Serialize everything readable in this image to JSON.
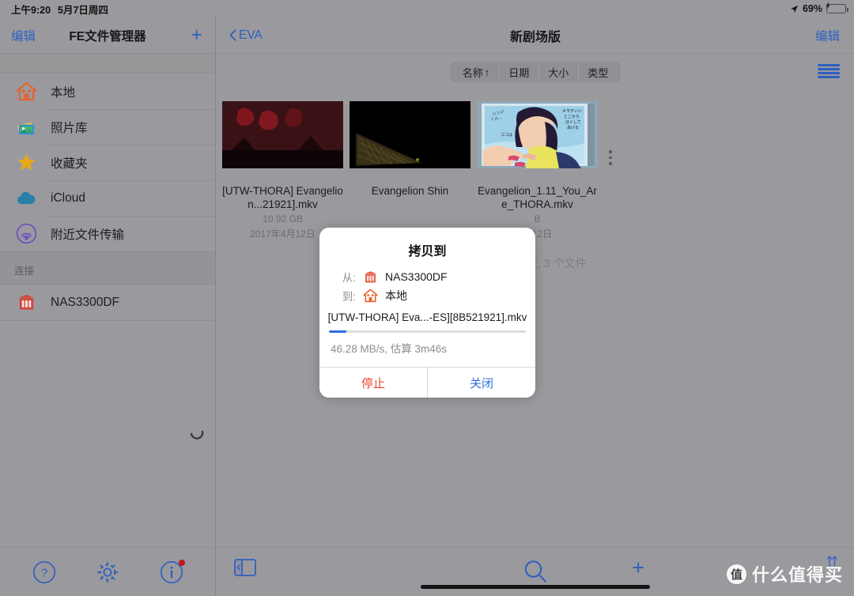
{
  "status_bar": {
    "time": "上午9:20",
    "date": "5月7日周四",
    "battery_percent": "69%",
    "location_icon": "location-arrow-icon",
    "battery_icon": "battery-charging-icon"
  },
  "sidebar": {
    "edit_label": "编辑",
    "title": "FE文件管理器",
    "add_label": "+",
    "items": [
      {
        "label": "本地",
        "icon": "home-icon"
      },
      {
        "label": "照片库",
        "icon": "photo-library-icon"
      },
      {
        "label": "收藏夹",
        "icon": "star-icon"
      },
      {
        "label": "iCloud",
        "icon": "cloud-icon"
      },
      {
        "label": "附近文件传输",
        "icon": "airdrop-icon"
      }
    ],
    "section_label": "连接",
    "connections": [
      {
        "label": "NAS3300DF",
        "icon": "nas-server-icon"
      }
    ],
    "toolbar": [
      {
        "name": "help-button",
        "icon": "question-circle-icon"
      },
      {
        "name": "settings-button",
        "icon": "gear-icon"
      },
      {
        "name": "info-button",
        "icon": "info-circle-icon",
        "badge": true
      }
    ]
  },
  "main": {
    "back_label": "EVA",
    "title": "新剧场版",
    "edit_label": "编辑",
    "sort_options": [
      {
        "label": "名称",
        "arrow": "↑",
        "active": true
      },
      {
        "label": "日期",
        "arrow": "",
        "active": false
      },
      {
        "label": "大小",
        "arrow": "",
        "active": false
      },
      {
        "label": "类型",
        "arrow": "",
        "active": false
      }
    ],
    "view_toggle_icon": "list-view-icon",
    "files": [
      {
        "name": "[UTW-THORA] Evangelion...21921].mkv",
        "size": "10.92 GB",
        "date": "2017年4月12日",
        "thumb": "dark-red-scene"
      },
      {
        "name": "Evangelion Shin",
        "size": "",
        "date": "",
        "thumb": "dark-building-scene"
      },
      {
        "name": "Evangelion_1.11_You_Are_THORA.mkv",
        "size": "B",
        "date": "月12日",
        "thumb": "anime-character-scene"
      }
    ],
    "footer_count": "0 个文件夹, 3 个文件",
    "toolbar": {
      "sidebar_toggle_icon": "sidebar-toggle-icon",
      "search_icon": "search-icon",
      "add_label": "+"
    }
  },
  "dialog": {
    "title": "拷贝到",
    "from_label": "从:",
    "from_value": "NAS3300DF",
    "from_icon": "nas-server-icon",
    "to_label": "到:",
    "to_value": "本地",
    "to_icon": "home-icon",
    "filename": "[UTW-THORA] Eva...-ES][8B521921].mkv",
    "progress_percent": 9,
    "status": "46.28 MB/s, 估算 3m46s",
    "stop_label": "停止",
    "close_label": "关闭"
  },
  "watermark": {
    "badge": "值",
    "text": "什么值得买"
  },
  "colors": {
    "accent_blue": "#2f5fbf",
    "dialog_blue": "#2f6fe0",
    "danger_red": "#f04128",
    "battery_green": "#4cd964",
    "background": "#9a9a9e"
  }
}
